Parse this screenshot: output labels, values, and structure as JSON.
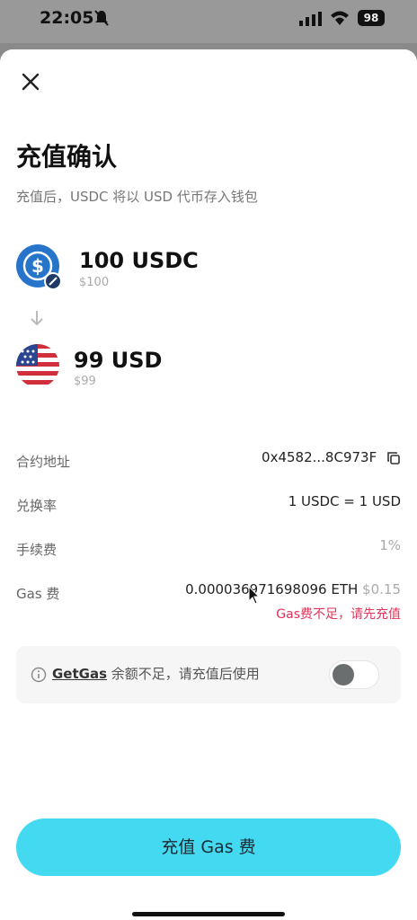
{
  "status_bar": {
    "time": "22:05",
    "battery": "98"
  },
  "header": {
    "title": "充值确认",
    "subtitle": "充值后，USDC 将以 USD 代币存入钱包"
  },
  "from": {
    "amount": "100 USDC",
    "fiat": "$100",
    "icon": "usdc-coin-icon"
  },
  "to": {
    "amount": "99 USD",
    "fiat": "$99",
    "icon": "us-flag-icon"
  },
  "details": {
    "contract": {
      "label": "合约地址",
      "value": "0x4582...8C973F"
    },
    "rate": {
      "label": "兑换率",
      "value": "1 USDC = 1 USD"
    },
    "fee": {
      "label": "手续费",
      "value": "1%"
    },
    "gas": {
      "label": "Gas 费",
      "value": "0.000036971698096 ETH",
      "fiat": "$0.15",
      "warning": "Gas费不足，请先充值"
    }
  },
  "getgas": {
    "link": "GetGas",
    "text": " 余额不足，请充值后使用",
    "enabled": false
  },
  "cta": {
    "label": "充值 Gas 费"
  },
  "colors": {
    "accent": "#43d9f0",
    "warning": "#e0325a",
    "usdc": "#2775ca"
  }
}
